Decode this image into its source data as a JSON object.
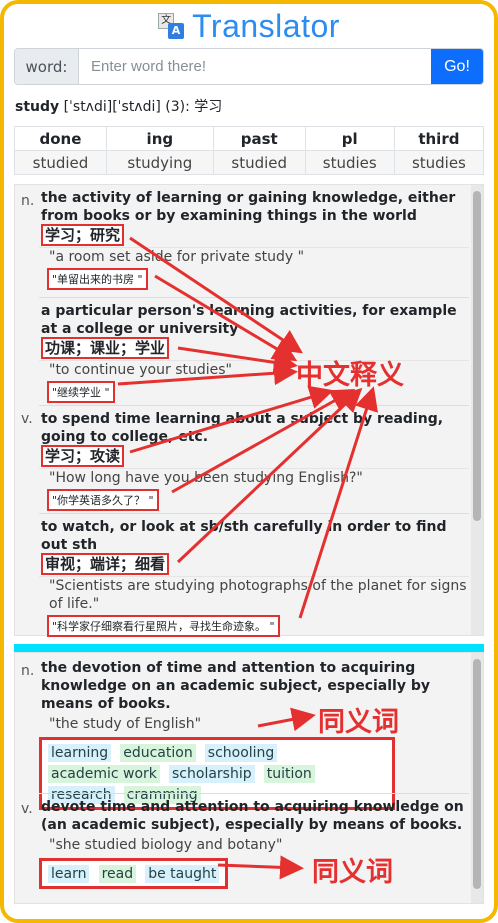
{
  "app": {
    "title": "Translator",
    "icon_left": "文",
    "icon_right": "A"
  },
  "search": {
    "label": "word:",
    "placeholder": "Enter word there!",
    "go": "Go!"
  },
  "headword": {
    "word": "study",
    "phonetic": " [ˈstʌdi][ˈstʌdi] (3):",
    "meaning": "学习"
  },
  "forms": {
    "headers": [
      "done",
      "ing",
      "past",
      "pl",
      "third"
    ],
    "values": [
      "studied",
      "studying",
      "studied",
      "studies",
      "studies"
    ]
  },
  "senses": [
    {
      "pos": "n.",
      "def": "the activity of learning or gaining knowledge, either from books or by examining things in the world",
      "zh": "学习；研究",
      "ex": "\"a room set aside for private study \"",
      "ex_zh": "\"单留出来的书房 \""
    },
    {
      "pos": "",
      "def": "a particular person's learning activities, for example at a college or university",
      "zh": "功课；课业；学业",
      "ex": "\"to continue your studies\"",
      "ex_zh": "\"继续学业 \""
    },
    {
      "pos": "v.",
      "def": "to spend time learning about a subject by reading, going to college, etc.",
      "zh": "学习；攻读",
      "ex": "\"How long have you been studying English?\"",
      "ex_zh": "\"你学英语多久了？ \""
    },
    {
      "pos": "",
      "def": "to watch, or look at sb/sth carefully in order to find out sth",
      "zh": "审视；端详；细看",
      "ex": "\"Scientists are studying photographs of the planet for signs of life.\"",
      "ex_zh": "\"科学家仔细察看行星照片，寻找生命迹象。 \""
    }
  ],
  "synonyms": [
    {
      "pos": "n.",
      "def": "the devotion of time and attention to acquiring knowledge on an academic subject, especially by means of books.",
      "ex": "\"the study of English\"",
      "words": [
        "learning",
        "education",
        "schooling",
        "academic work",
        "scholarship",
        "tuition",
        "research",
        "cramming"
      ]
    },
    {
      "pos": "v.",
      "def": "devote time and attention to acquiring knowledge on (an academic subject), especially by means of books.",
      "ex": "\"she studied biology and botany\"",
      "words": [
        "learn",
        "read",
        "be taught"
      ]
    }
  ],
  "callouts": {
    "chinese_meaning": "中文释义",
    "synonym_1": "同义词",
    "synonym_2": "同义词"
  },
  "colors": {
    "brand": "#2d8cf0",
    "go_button": "#0d6efd",
    "annotation": "#e53030",
    "divider": "#00e1ff",
    "frame": "#f5b800"
  }
}
